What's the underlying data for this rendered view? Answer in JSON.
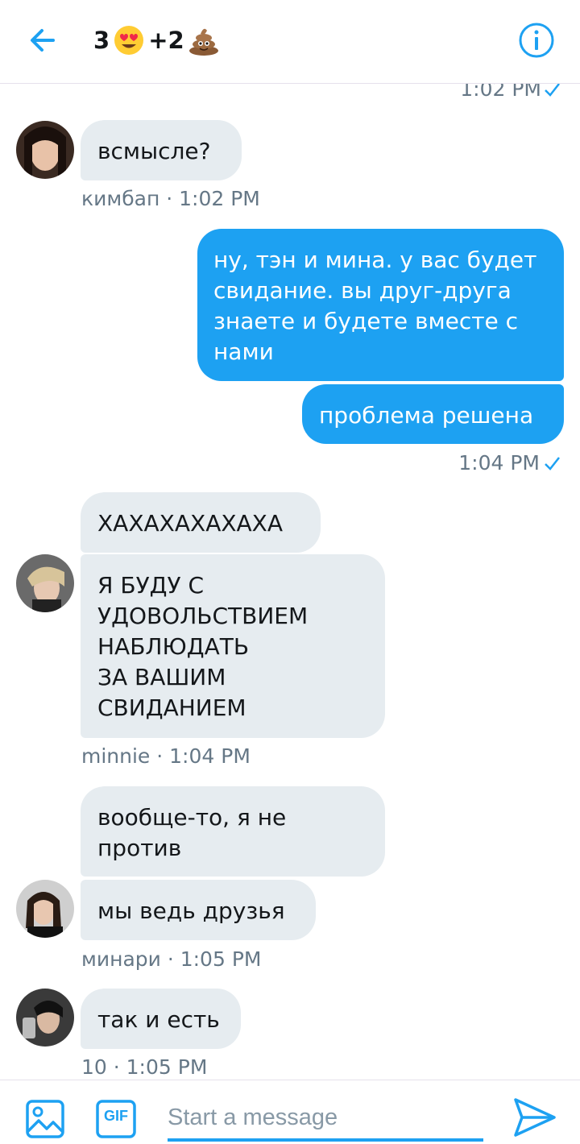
{
  "header": {
    "title_count_1": "3",
    "title_emoji_1": "heart-eyes-emoji",
    "title_plus": "+2",
    "title_emoji_2": "poop-emoji",
    "accent": "#1da1f2"
  },
  "messages": {
    "top_time": "1:02 PM",
    "kimbap_msg": "всмысле?",
    "kimbap_meta": "кимбап · 1:02 PM",
    "out_msg_1_line1": "ну, тэн и мина. у вас будет",
    "out_msg_1_line2": "свидание. вы друг-друга",
    "out_msg_1_line3": "знаете и будете вместе с",
    "out_msg_1_line4": "нами",
    "out_msg_2": "проблема решена",
    "out_time": "1:04 PM",
    "minnie_msg_1": "ХАХАХАХАХАХА",
    "minnie_msg_2_line1": "Я БУДУ С",
    "minnie_msg_2_line2": "УДОВОЛЬСТВИЕМ",
    "minnie_msg_2_line3": "НАБЛЮДАТЬ",
    "minnie_msg_2_line4": "ЗА ВАШИМ",
    "minnie_msg_2_line5": "СВИДАНИЕМ",
    "minnie_meta": "minnie · 1:04 PM",
    "minari_msg_1_line1": "вообще-то, я не",
    "minari_msg_1_line2": "против",
    "minari_msg_2": "мы ведь друзья",
    "minari_meta": "минари · 1:05 PM",
    "ten_msg": "так и есть",
    "ten_meta": "10 · 1:05 PM"
  },
  "composer": {
    "placeholder": "Start a message",
    "gif_label": "GIF"
  }
}
